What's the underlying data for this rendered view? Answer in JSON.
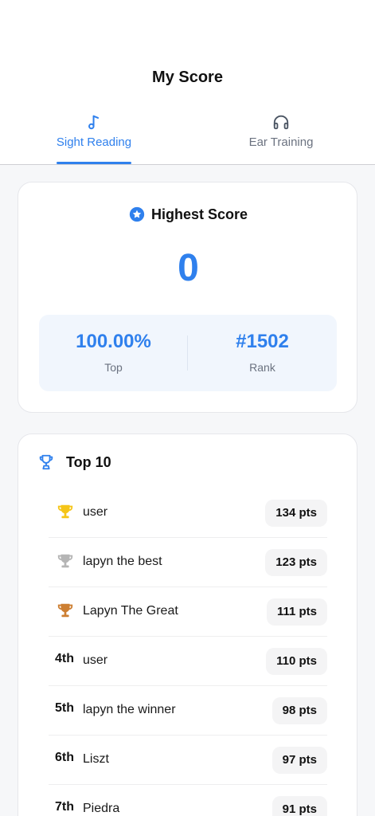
{
  "header": {
    "title": "My Score",
    "tabs": [
      {
        "label": "Sight Reading",
        "icon": "music-note-icon",
        "active": true
      },
      {
        "label": "Ear Training",
        "icon": "headphones-icon",
        "active": false
      }
    ]
  },
  "highest_score": {
    "title": "Highest Score",
    "icon": "star-badge-icon",
    "value": "0",
    "top_value": "100.00%",
    "top_label": "Top",
    "rank_value": "#1502",
    "rank_label": "Rank"
  },
  "top10": {
    "title": "Top 10",
    "icon": "trophy-icon",
    "rows": [
      {
        "pos": "",
        "medal": "gold",
        "name": "user",
        "pts": "134 pts"
      },
      {
        "pos": "",
        "medal": "silver",
        "name": "lapyn the best",
        "pts": "123 pts"
      },
      {
        "pos": "",
        "medal": "bronze",
        "name": "Lapyn The Great",
        "pts": "111 pts"
      },
      {
        "pos": "4th",
        "medal": "",
        "name": "user",
        "pts": "110 pts"
      },
      {
        "pos": "5th",
        "medal": "",
        "name": "lapyn the winner",
        "pts": "98 pts"
      },
      {
        "pos": "6th",
        "medal": "",
        "name": "Liszt",
        "pts": "97 pts"
      },
      {
        "pos": "7th",
        "medal": "",
        "name": "Piedra",
        "pts": "91 pts"
      }
    ]
  },
  "colors": {
    "accent": "#2f80ed",
    "gold": "#f5c518",
    "silver": "#b5b5b5",
    "bronze": "#cd7f32"
  }
}
